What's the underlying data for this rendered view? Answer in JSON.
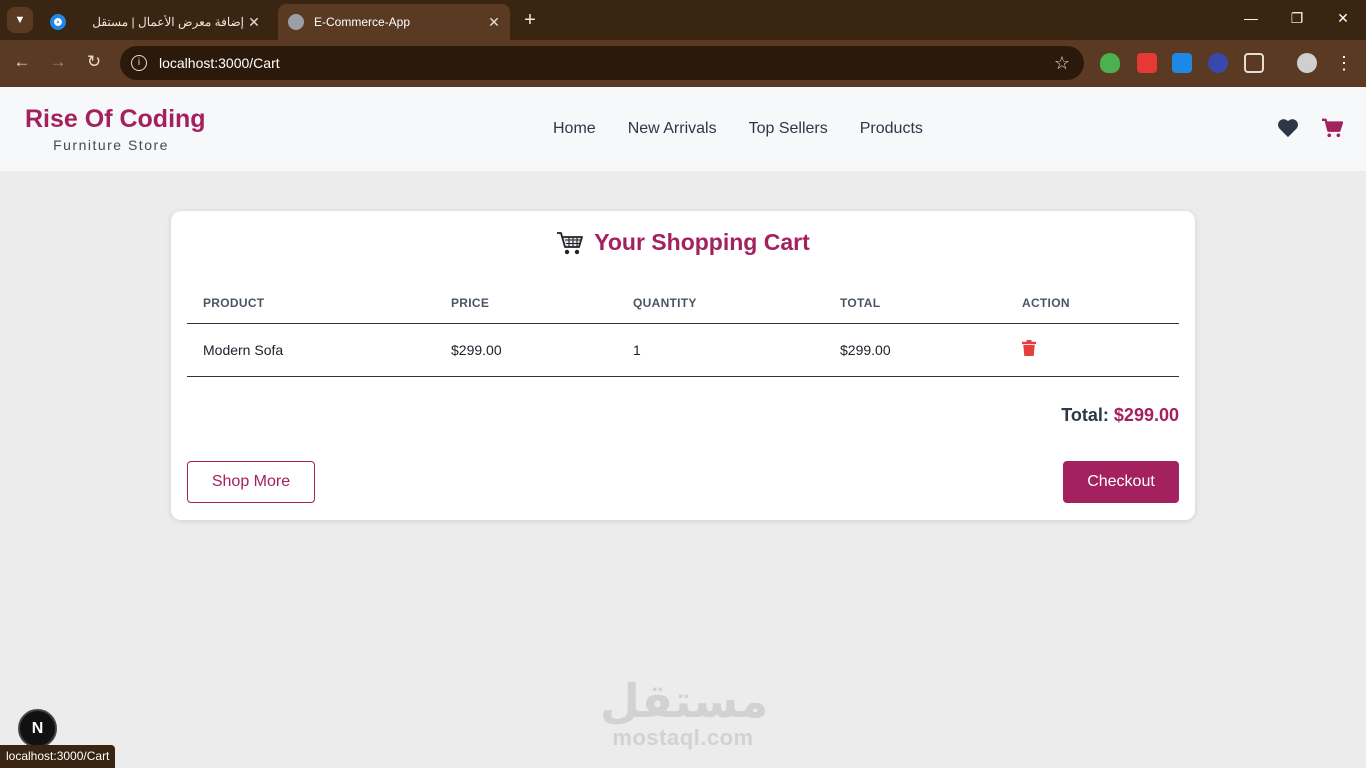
{
  "browser": {
    "tabs": [
      {
        "title": "إضافة معرض الأعمال | مستقل",
        "active": false
      },
      {
        "title": "E-Commerce-App",
        "active": true
      }
    ],
    "url": "localhost:3000/Cart",
    "status_url": "localhost:3000/Cart",
    "icons": [
      "chevron-down-icon",
      "close-icon",
      "plus-icon",
      "minimize-icon",
      "restore-icon",
      "back-icon",
      "forward-icon",
      "reload-icon",
      "info-icon",
      "star-icon",
      "extension-shield-icon",
      "extension-icon",
      "download-icon",
      "puzzle-icon",
      "profile-avatar",
      "kebab-menu-icon"
    ]
  },
  "site": {
    "brand_name": "Rise Of Coding",
    "brand_tagline": "Furniture Store",
    "nav": [
      "Home",
      "New Arrivals",
      "Top Sellers",
      "Products"
    ],
    "icons": [
      "heart-icon",
      "cart-icon"
    ]
  },
  "cart": {
    "heading": "Your Shopping Cart",
    "columns": [
      "PRODUCT",
      "PRICE",
      "QUANTITY",
      "TOTAL",
      "ACTION"
    ],
    "items": [
      {
        "product": "Modern Sofa",
        "price": "$299.00",
        "quantity": "1",
        "total": "$299.00",
        "action_icon": "trash-icon"
      }
    ],
    "total_label": "Total:",
    "total_value": "$299.00",
    "shop_more_label": "Shop More",
    "checkout_label": "Checkout"
  },
  "watermark": {
    "arabic": "مستقل",
    "latin": "mostaql.com"
  },
  "dev_badge": "N",
  "colors": {
    "accent": "#a3215e",
    "delete": "#e53e3e",
    "chrome": "#3a2412"
  }
}
